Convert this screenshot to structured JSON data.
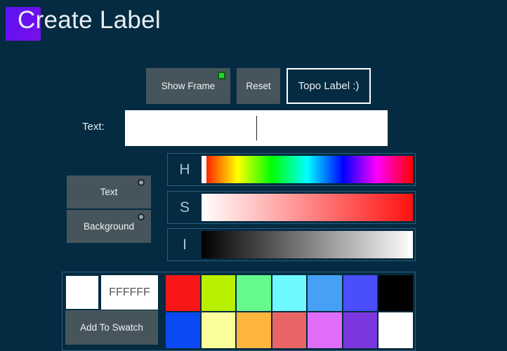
{
  "header": {
    "title": "Create Label",
    "logo_color_start": "#5a14f4",
    "logo_color_end": "#7a10e8"
  },
  "toolbar": {
    "show_frame_label": "Show Frame",
    "show_frame_indicator_color": "#21d92b",
    "reset_label": "Reset",
    "topo_label": "Topo Label :)"
  },
  "text_row": {
    "label": "Text:",
    "value": "",
    "placeholder": ""
  },
  "sliders": [
    {
      "letter": "H",
      "handle": "left"
    },
    {
      "letter": "S",
      "handle": "left"
    },
    {
      "letter": "I",
      "handle": "right"
    }
  ],
  "targets": {
    "text_label": "Text",
    "background_label": "Background"
  },
  "swatch": {
    "preview_color": "#FFFFFF",
    "hex_value": "FFFFFF",
    "add_button_label": "Add To Swatch",
    "colors": [
      "#f81616",
      "#b8f000",
      "#66f98b",
      "#6ef9ff",
      "#46a0f5",
      "#4b4ffb",
      "#000000",
      "#0b4af2",
      "#fcfd9b",
      "#fdb53c",
      "#e96565",
      "#e06cfa",
      "#7b37dd",
      "#ffffff"
    ]
  },
  "colors": {
    "background": "#042b41",
    "button": "#46555c",
    "panel_border": "#2a5f7d",
    "text": "#eef3f6"
  }
}
